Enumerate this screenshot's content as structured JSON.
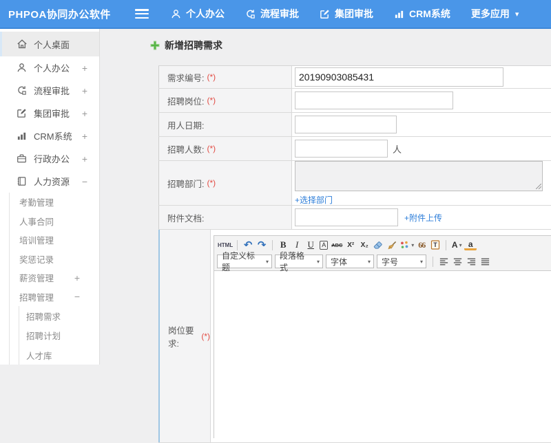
{
  "colors": {
    "header_bg": "#4a96e8",
    "link_blue": "#2d7ed9",
    "required_red": "#e24a42",
    "plus_green": "#57b447"
  },
  "icons": {
    "caret_down": "▾",
    "undo": "↶",
    "redo": "↷",
    "plus": "+",
    "minus": "−"
  },
  "header": {
    "logo": "PHPOA协同办公软件",
    "nav": [
      {
        "label": "个人办公"
      },
      {
        "label": "流程审批"
      },
      {
        "label": "集团审批"
      },
      {
        "label": "CRM系统"
      },
      {
        "label": "更多应用"
      }
    ]
  },
  "sidebar": {
    "items": [
      {
        "label": "个人桌面",
        "expander": ""
      },
      {
        "label": "个人办公",
        "expander": "+"
      },
      {
        "label": "流程审批",
        "expander": "+"
      },
      {
        "label": "集团审批",
        "expander": "+"
      },
      {
        "label": "CRM系统",
        "expander": "+"
      },
      {
        "label": "行政办公",
        "expander": "+"
      },
      {
        "label": "人力资源",
        "expander": "−"
      }
    ],
    "hr_submenu": [
      {
        "label": "考勤管理",
        "expander": ""
      },
      {
        "label": "人事合同",
        "expander": ""
      },
      {
        "label": "培训管理",
        "expander": ""
      },
      {
        "label": "奖惩记录",
        "expander": ""
      },
      {
        "label": "薪资管理",
        "expander": "+"
      },
      {
        "label": "招聘管理",
        "expander": "−"
      }
    ],
    "recruit_submenu": [
      {
        "label": "招聘需求"
      },
      {
        "label": "招聘计划"
      },
      {
        "label": "人才库"
      }
    ]
  },
  "main": {
    "title": "新增招聘需求",
    "required_mark": "(*)",
    "form": {
      "labels": {
        "code": "需求编号:",
        "position": "招聘岗位:",
        "date": "用人日期:",
        "count": "招聘人数:",
        "department": "招聘部门:",
        "attachment": "附件文档:",
        "requirement": "岗位要求:"
      },
      "values": {
        "code": "20190903085431"
      },
      "unit_person": "人",
      "links": {
        "select_department": "+选择部门",
        "upload_attachment": "+附件上传"
      }
    }
  },
  "editor": {
    "buttons": {
      "source": "HTML",
      "bold": "B",
      "italic": "I",
      "underline": "U",
      "quickformat": "A",
      "strikethrough": "ABC",
      "superscript": "X²",
      "subscript": "X₂",
      "blockquote": "66",
      "paste_letter": "T",
      "forecolor": "A",
      "hilitecolor": "a"
    },
    "selects": [
      {
        "label": "自定义标题"
      },
      {
        "label": "段落格式"
      },
      {
        "label": "字体"
      },
      {
        "label": "字号"
      }
    ]
  }
}
